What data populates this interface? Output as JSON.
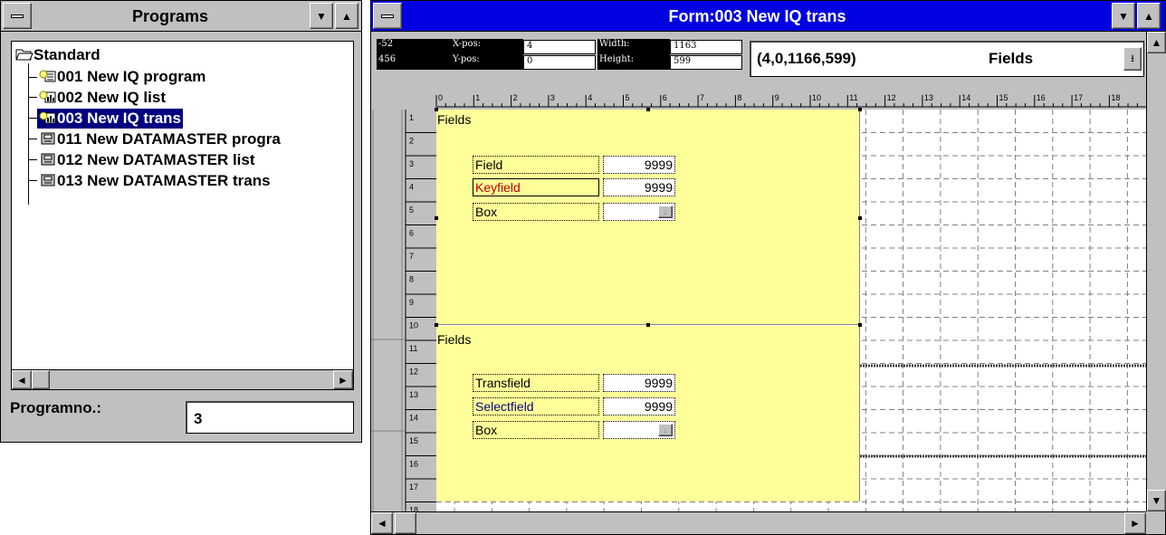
{
  "programs_window": {
    "title": "Programs",
    "tree": {
      "root_label": "Standard",
      "items": [
        {
          "label": "001  New IQ program",
          "icon": "program-icon",
          "selected": false
        },
        {
          "label": "002  New IQ list",
          "icon": "list-icon",
          "selected": false
        },
        {
          "label": "003  New IQ trans",
          "icon": "trans-icon",
          "selected": true
        },
        {
          "label": "011  New DATAMASTER progra",
          "icon": "datamaster-icon",
          "selected": false
        },
        {
          "label": "012  New DATAMASTER list",
          "icon": "datamaster-icon",
          "selected": false
        },
        {
          "label": "013  New DATAMASTER trans",
          "icon": "datamaster-icon",
          "selected": false
        }
      ]
    },
    "programno_label": "Programno.:",
    "programno_value": "3"
  },
  "form_window": {
    "title": "Form:003  New IQ trans",
    "cursor_x": "-52",
    "cursor_y": "456",
    "xpos_label": "X-pos:",
    "xpos_value": "4",
    "ypos_label": "Y-pos:",
    "ypos_value": "0",
    "width_label": "Width:",
    "width_value": "1163",
    "height_label": "Height:",
    "height_value": "599",
    "coords_text": "(4,0,1166,599)",
    "section_select_value": "Fields",
    "ruler_top": [
      "0",
      "1",
      "2",
      "3",
      "4",
      "5",
      "6",
      "7",
      "8",
      "9",
      "10",
      "11",
      "12",
      "13",
      "14",
      "15",
      "16",
      "17",
      "18"
    ],
    "ruler_left": [
      "1",
      "2",
      "3",
      "4",
      "5",
      "6",
      "7",
      "8",
      "9",
      "10",
      "11",
      "12",
      "13",
      "14",
      "15",
      "16",
      "17",
      "18"
    ],
    "section1": {
      "label": "Fields",
      "fields": [
        {
          "label": "Field",
          "value": "9999"
        },
        {
          "label": "Keyfield",
          "value": "9999"
        },
        {
          "label": "Box",
          "value": ""
        }
      ]
    },
    "section2": {
      "label": "Fields",
      "fields": [
        {
          "label": "Transfield",
          "value": "9999"
        },
        {
          "label": "Selectfield",
          "value": "9999"
        },
        {
          "label": "Box",
          "value": ""
        }
      ]
    }
  },
  "colors": {
    "title_active": "#0000e0",
    "selection": "#000080",
    "design_background": "#ffff99",
    "keyfield_text": "#c00000",
    "selectfield_text": "#000080"
  }
}
